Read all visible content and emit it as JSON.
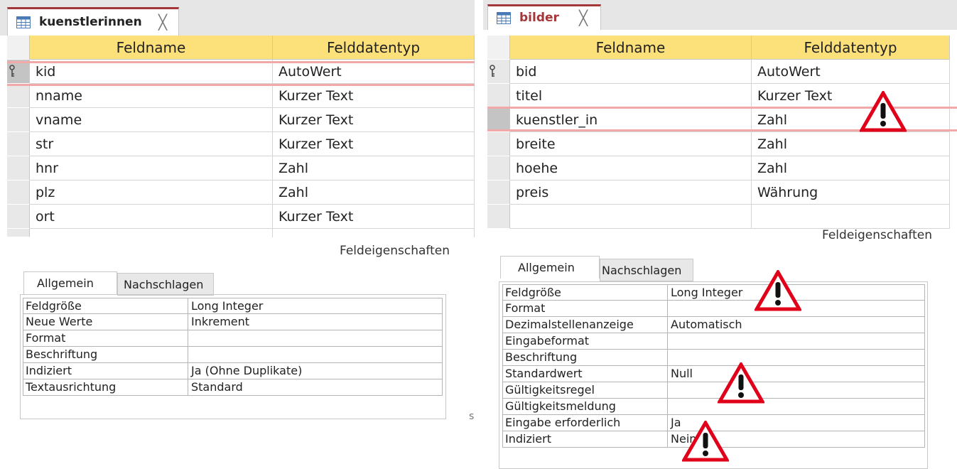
{
  "left": {
    "tab_title": "kuenstlerinnen",
    "tab_close": "╳",
    "columns": [
      "Feldname",
      "Felddatentyp"
    ],
    "rows": [
      {
        "name": "kid",
        "type": "AutoWert"
      },
      {
        "name": "nname",
        "type": "Kurzer Text"
      },
      {
        "name": "vname",
        "type": "Kurzer Text"
      },
      {
        "name": "str",
        "type": "Kurzer Text"
      },
      {
        "name": "hnr",
        "type": "Zahl"
      },
      {
        "name": "plz",
        "type": "Zahl"
      },
      {
        "name": "ort",
        "type": "Kurzer Text"
      }
    ],
    "feldeigenschaften": "Feldeigenschaften",
    "tab_general": "Allgemein",
    "tab_lookup": "Nachschlagen",
    "properties": [
      {
        "name": "Feldgröße",
        "value": "Long Integer"
      },
      {
        "name": "Neue Werte",
        "value": "Inkrement"
      },
      {
        "name": "Format",
        "value": ""
      },
      {
        "name": "Beschriftung",
        "value": ""
      },
      {
        "name": "Indiziert",
        "value": "Ja (Ohne Duplikate)"
      },
      {
        "name": "Textausrichtung",
        "value": "Standard"
      }
    ],
    "stray_char": "s"
  },
  "right": {
    "tab_title": "bilder",
    "tab_close": "╳",
    "columns": [
      "Feldname",
      "Felddatentyp"
    ],
    "rows": [
      {
        "name": "bid",
        "type": "AutoWert"
      },
      {
        "name": "titel",
        "type": "Kurzer Text"
      },
      {
        "name": "kuenstler_in",
        "type": "Zahl"
      },
      {
        "name": "breite",
        "type": "Zahl"
      },
      {
        "name": "hoehe",
        "type": "Zahl"
      },
      {
        "name": "preis",
        "type": "Währung"
      }
    ],
    "feldeigenschaften": "Feldeigenschaften",
    "tab_general": "Allgemein",
    "tab_lookup": "Nachschlagen",
    "properties": [
      {
        "name": "Feldgröße",
        "value": "Long Integer"
      },
      {
        "name": "Format",
        "value": ""
      },
      {
        "name": "Dezimalstellenanzeige",
        "value": "Automatisch"
      },
      {
        "name": "Eingabeformat",
        "value": ""
      },
      {
        "name": "Beschriftung",
        "value": ""
      },
      {
        "name": "Standardwert",
        "value": "Null"
      },
      {
        "name": "Gültigkeitsregel",
        "value": ""
      },
      {
        "name": "Gültigkeitsmeldung",
        "value": ""
      },
      {
        "name": "Eingabe erforderlich",
        "value": "Ja"
      },
      {
        "name": "Indiziert",
        "value": "Nein"
      }
    ]
  },
  "colors": {
    "header_yellow": "#fce07a",
    "tab_accent": "#a4373a",
    "warning_red": "#e0001a"
  },
  "icons": {
    "table": "table-icon",
    "key": "primary-key-icon",
    "warning": "warning-triangle-icon"
  }
}
